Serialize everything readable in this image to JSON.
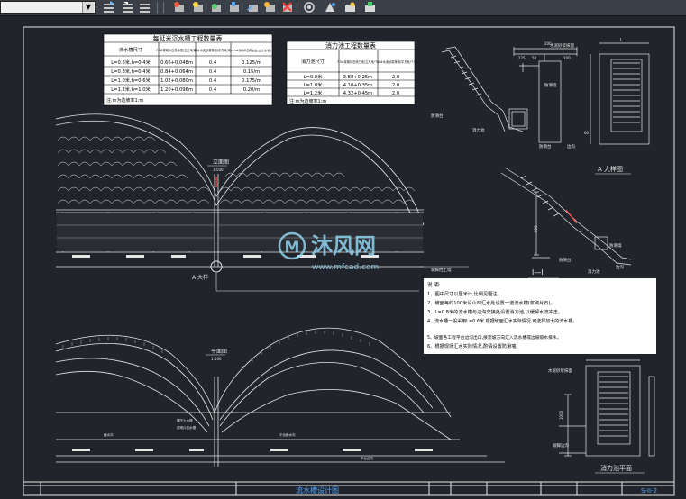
{
  "toolbar": {
    "layer_combo_value": "",
    "tools": [
      "layer-match-icon",
      "layer-prev-icon",
      "layer-state-icon",
      "layer-isolate-icon",
      "layer-off-icon",
      "layer-freeze-icon",
      "layer-lock-icon",
      "layer-change-icon",
      "layer-merge-icon",
      "layer-delete-icon",
      "layer-walk-icon",
      "layer-unisolate-icon",
      "layer-on-icon"
    ]
  },
  "drawing": {
    "table1": {
      "title": "每延米沉水槽工程数量表",
      "headers": [
        "流水槽尺寸",
        "7.5#浆砌片石流水槽(立方米/米)",
        "10#水泥砂浆抹面(平方米/米)",
        "7.5#浆砌片石砌边台(立方米/道)"
      ],
      "rows": [
        [
          "L=0.6米,h=0.4米",
          "0.66+0.048m",
          "0.4",
          "0.125/m"
        ],
        [
          "L=0.8米,h=0.4米",
          "0.84+0.064m",
          "0.4",
          "0.15/m"
        ],
        [
          "L=1.0米,h=0.6米",
          "1.02+0.080m",
          "0.4",
          "0.175/m"
        ],
        [
          "L=1.2米,h=1.0米",
          "1.20+0.096m",
          "0.4",
          "0.20/m"
        ]
      ],
      "note": "注:m为边坡率1:m"
    },
    "table2": {
      "title": "消力池工程数量表",
      "headers": [
        "消力池尺寸",
        "7.5#浆砌片石消力池(立方米/个)",
        "10#水泥砂浆抹面(平方米/个)"
      ],
      "rows": [
        [
          "L=0.8米",
          "3.88+0.25m",
          "2.0"
        ],
        [
          "L=1.0米",
          "4.10+0.35m",
          "2.0"
        ],
        [
          "L=1.2米",
          "4.32+0.45m",
          "2.0"
        ]
      ],
      "note": "注:m为边坡率1:m"
    },
    "labels": {
      "elevation_view": "立面图",
      "elevation_scale": "1:500",
      "plan_view": "平面图",
      "plan_scale": "1:500",
      "detail_a_mark": "A 大样",
      "detail_a_title": "A 大样图",
      "section_title": "I—I",
      "pool_plan_title": "消力池平面",
      "mortar_label": "水泥砂浆抹面",
      "mortar_label2": "水泥砂浆抹面",
      "anti_slip": "防滑台",
      "anti_slip2": "防滑台",
      "anti_slip3": "防滑台",
      "slide_wall": "防滑墙",
      "slide_wall2": "防滑墙",
      "stilling_pool": "消力池",
      "stilling_pool2": "消力池",
      "side_ditch": "边沟",
      "side_ditch2": "边沟",
      "slope_toe": "坡脚边沟",
      "toe_wall": "坡脚挡土墙",
      "dim_200": "200",
      "dim_125": "125",
      "dim_50": "50",
      "dim_100": "100",
      "dim_60": "60",
      "dim_800": "800",
      "dim_1000": "1000",
      "dim_L": "L",
      "plan_label1": "碾压土水槽",
      "plan_label2": "浆砌片石水槽",
      "plan_label3": "截水沟",
      "plan_label4": "平台截水沟",
      "plan_label5": "平台边沟"
    },
    "notes": {
      "heading": "说    明:",
      "items": [
        "1、图中尺寸以厘米计,比例见图注。",
        "2、坡面每约100米设山凹汇水处设置一道流水槽(浆砌片石)。",
        "3、L=0.8米的流水槽与边沟交接处设置消力池,以缓解水流冲击。",
        "4、流水槽一般采用L=0.6米,根据坡面汇水实际情况,可选择加大的流水槽。",
        "5、坡面各工程平台边沟出口,接流坡方向汇入流水槽或边坡吸水排水。",
        "6、根据现场汇水实际情况,酌情设置防滑墙。"
      ]
    },
    "watermark": {
      "main": "沐风网",
      "url": "www.mfcad.com"
    },
    "title_block": {
      "drawing_name": "流水槽设计图",
      "sheet_no": "S-II-2"
    }
  },
  "colors": {
    "background": "#21252b",
    "line": "#e6e6e6",
    "accent": "#ff4a4a",
    "watermark": "#8fd3ee"
  }
}
